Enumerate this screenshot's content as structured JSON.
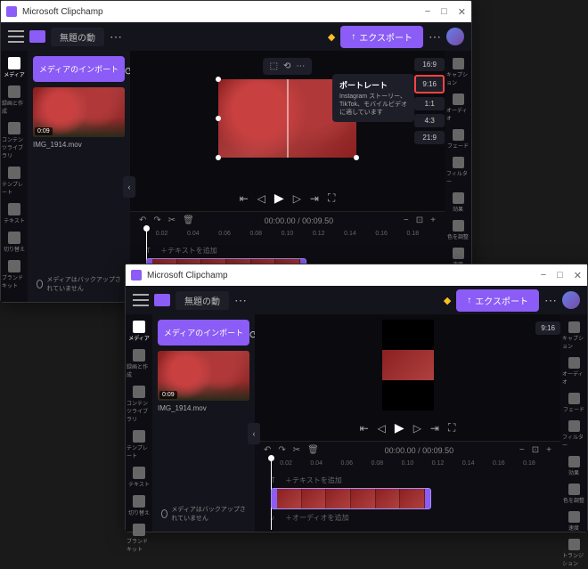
{
  "app_title": "Microsoft Clipchamp",
  "project_name": "無題の動",
  "export_label": "エクスポート",
  "left_rail": [
    {
      "label": "メディア"
    },
    {
      "label": "録画と作成"
    },
    {
      "label": "コンテンツライブラリ"
    },
    {
      "label": "テンプレート"
    },
    {
      "label": "テキスト"
    },
    {
      "label": "切り替え"
    },
    {
      "label": "ブランドキット"
    }
  ],
  "import_label": "メディアのインポート",
  "clip_duration": "0:09",
  "clip_filename": "IMG_1914.mov",
  "backup_msg": "メディアはバックアップされていません",
  "aspect_ratios": [
    "16:9",
    "9:16",
    "1:1",
    "4:3",
    "21:9"
  ],
  "tooltip": {
    "title": "ポートレート",
    "body": "Instagram ストーリー、TikTok、モバイルビデオに適しています"
  },
  "time_display": "00:00.00 / 00:09.50",
  "ruler": [
    "0.02",
    "0.04",
    "0.06",
    "0.08",
    "0.10",
    "0.12",
    "0.14",
    "0.16",
    "0.18"
  ],
  "track_text": "＋テキストを追加",
  "track_audio": "＋オーディオを追加",
  "right_rail": [
    {
      "label": "キャプション"
    },
    {
      "label": "オーディオ"
    },
    {
      "label": "フェード"
    },
    {
      "label": "フィルター"
    },
    {
      "label": "効果"
    },
    {
      "label": "色を調整"
    },
    {
      "label": "速度"
    }
  ],
  "right_rail2_extra": {
    "label": "トランジション"
  },
  "ar_selected_w2": "9:16"
}
